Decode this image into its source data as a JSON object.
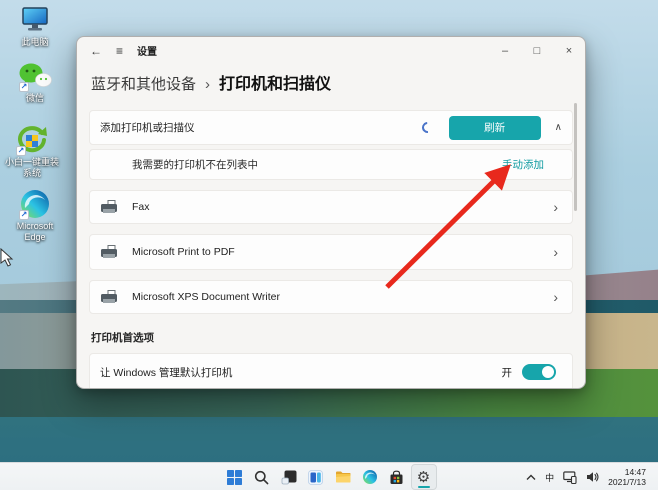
{
  "glyphs": {
    "back": "←",
    "menu": "≡",
    "minimize": "–",
    "maximize": "□",
    "close": "×",
    "chevron_right": "›",
    "chevron_up": "∧",
    "gear": "⚙",
    "shortcut_arrow": "↗"
  },
  "colors": {
    "accent_teal": "#17a5ab",
    "link_teal": "#0f9ba1",
    "annotation_red": "#e8291d",
    "spinner_blue": "#4a74c9",
    "taskbar_bg": "#f2f4f6"
  },
  "desktop": {
    "icons": [
      {
        "icon": "this-pc-icon",
        "label": "此电脑"
      },
      {
        "icon": "wechat-icon",
        "label": "微信"
      },
      {
        "icon": "reinstall-tool-icon",
        "label": "小白一键重装系统"
      },
      {
        "icon": "edge-icon",
        "label": "Microsoft Edge"
      }
    ]
  },
  "settings_window": {
    "titlebar": {
      "title": "设置"
    },
    "breadcrumb": {
      "parent": "蓝牙和其他设备",
      "separator": "›",
      "current": "打印机和扫描仪"
    },
    "add_section": {
      "label": "添加打印机或扫描仪",
      "refresh_button": "刷新"
    },
    "not_listed": {
      "label": "我需要的打印机不在列表中",
      "manual_add_link": "手动添加"
    },
    "printers": [
      {
        "name": "Fax"
      },
      {
        "name": "Microsoft Print to PDF"
      },
      {
        "name": "Microsoft XPS Document Writer"
      }
    ],
    "preferences": {
      "section_title": "打印机首选项",
      "default_printer_label": "让 Windows 管理默认打印机",
      "toggle_state_label": "开",
      "toggle_on": true
    }
  },
  "taskbar": {
    "center_icons": [
      "start",
      "search",
      "task-view",
      "widgets",
      "file-explorer",
      "edge",
      "store",
      "settings"
    ],
    "active_icon": "settings",
    "tray": {
      "hidden_icons_icon": "chevron-up",
      "ime_label": "中",
      "network_icon": "network",
      "volume_icon": "volume",
      "time": "14:47",
      "date": "2021/7/13"
    }
  }
}
